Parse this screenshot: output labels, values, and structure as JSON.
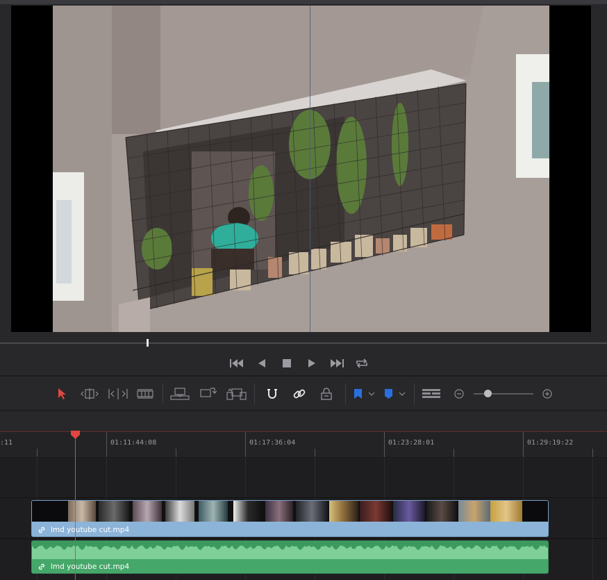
{
  "viewer": {
    "description_icon": "video-frame",
    "scrub_position": 0.243
  },
  "transport": {
    "buttons": [
      "go-to-start-icon",
      "play-reverse-icon",
      "stop-icon",
      "play-icon",
      "go-to-end-icon",
      "loop-icon"
    ]
  },
  "toolbar": {
    "tools": [
      "selection-arrow-icon",
      "trim-edit-icon",
      "dynamic-trim-icon",
      "blade-icon",
      "insert-clip-icon",
      "overwrite-clip-icon",
      "replace-clip-icon",
      "snapping-icon",
      "linked-selection-icon",
      "position-lock-icon",
      "flag-icon",
      "marker-icon",
      "timeline-view-icon",
      "zoom-out-icon",
      "zoom-in-icon"
    ],
    "accent_color": "#e0473f",
    "flag_color": "#2a6fe0",
    "zoom_level": 0.23
  },
  "ruler": {
    "timecodes": [
      ":11",
      "01:11:44:08",
      "01:17:36:04",
      "01:23:28:01",
      "01:29:19:22"
    ]
  },
  "clips": {
    "video_name": "lmd youtube cut.mp4",
    "audio_name": "lmd youtube cut.mp4",
    "video_color": "#8cb4d8",
    "audio_color": "#45a769"
  }
}
